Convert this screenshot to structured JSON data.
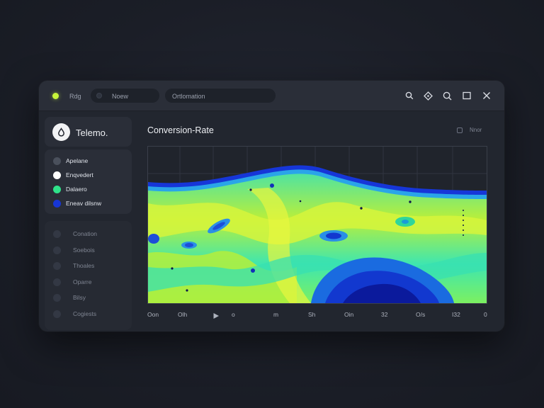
{
  "titlebar": {
    "app_label": "Rdg",
    "tab_label": "Noew",
    "search_label": "Ortlomation",
    "icons": [
      "search-icon",
      "diamond-icon",
      "magnifier-icon",
      "maximize-icon",
      "close-icon"
    ]
  },
  "brand": {
    "name": "Telemo.",
    "icon": "drop-icon"
  },
  "layers": [
    {
      "label": "Apelane",
      "color": "#4a505c"
    },
    {
      "label": "Enqvedert",
      "color": "#ffffff"
    },
    {
      "label": "Dalaero",
      "color": "#2fe38a"
    },
    {
      "label": "Eneav dilsnw",
      "color": "#1736d6"
    }
  ],
  "nav": [
    {
      "label": "Conation"
    },
    {
      "label": "Soebois"
    },
    {
      "label": "Thoales"
    },
    {
      "label": "Oparre"
    },
    {
      "label": "Bilsy"
    },
    {
      "label": "Cogiests"
    }
  ],
  "chart": {
    "title": "Conversion-Rate",
    "legend_toggle": "Nnor"
  },
  "timeline": {
    "labels": [
      "Oon",
      "Olh",
      "o",
      "m",
      "Sh",
      "Oin",
      "32",
      "O/s",
      "I32",
      "0"
    ]
  },
  "colors": {
    "accent_live": "#c7f53a",
    "heat_low": "#0d1fbf",
    "heat_mid": "#2fe0a0",
    "heat_high": "#d8f53a"
  }
}
